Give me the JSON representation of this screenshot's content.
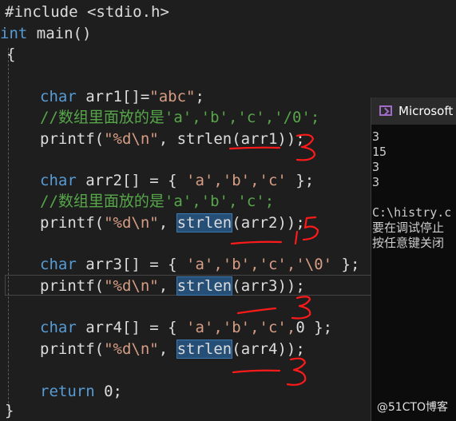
{
  "code_lines": {
    "l1": "#include <stdio.h>",
    "l2_kw": "int",
    "l2_rest": " main()",
    "l3": "{",
    "l5_kw": "char",
    "l5_rest": " arr1[]=",
    "l5_str": "\"abc\"",
    "l5_end": ";",
    "l6": "//数组里面放的是'a','b','c','/0';",
    "l7_a": "printf(",
    "l7_str": "\"%d\\n\"",
    "l7_b": ", strlen(arr1));",
    "l9_kw": "char",
    "l9_rest": " arr2[] = { ",
    "l9_lits": "'a','b','c'",
    "l9_end": " };",
    "l10": "//数组里面放的是'a','b','c';",
    "l11_a": "printf(",
    "l11_str": "\"%d\\n\"",
    "l11_b": ", ",
    "l11_fn": "strlen",
    "l11_c": "(arr2));",
    "l13_kw": "char",
    "l13_rest": " arr3[] = { ",
    "l13_lits": "'a','b','c','\\0'",
    "l13_end": " };",
    "l14_a": "printf(",
    "l14_str": "\"%d\\n\"",
    "l14_b": ", ",
    "l14_fn": "strlen",
    "l14_c": "(arr3));",
    "l16_kw": "char",
    "l16_rest": " arr4[] = { ",
    "l16_lits": "'a','b','c',",
    "l16_num": "0",
    "l16_end": " };",
    "l17_a": "printf(",
    "l17_str": "\"%d\\n\"",
    "l17_b": ", ",
    "l17_fn": "strlen",
    "l17_c": "(arr4));",
    "l19_kw": "return",
    "l19_rest": " 0;",
    "l20": "}"
  },
  "console": {
    "title": "Microsoft Visual Studio 调试控制台",
    "output": "3\n15\n3\n3\n\nC:\\histry.c\n要在调试停止\n按任意键关闭"
  },
  "annotations": {
    "a1": "3",
    "a2": "15",
    "a3": "3",
    "a4": "3"
  },
  "watermark": "@51CTO博客",
  "colors": {
    "keyword": "#569cd6",
    "string": "#d69d85",
    "comment": "#57a64a",
    "annotation": "#ff1a1a"
  }
}
